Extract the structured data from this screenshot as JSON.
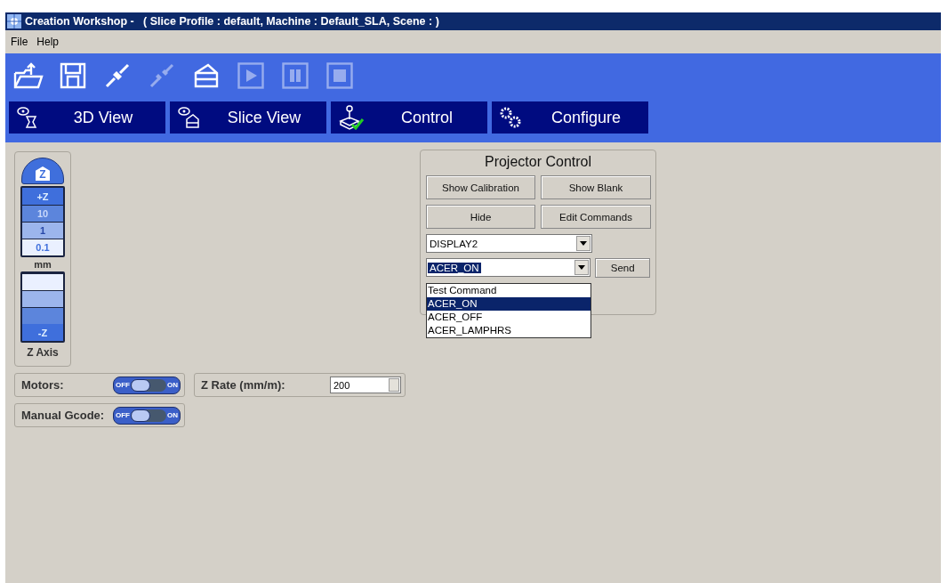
{
  "window": {
    "title": "Creation Workshop -   ( Slice Profile : default, Machine : Default_SLA, Scene : )"
  },
  "menu": [
    "File",
    "Help"
  ],
  "toolbar": [
    {
      "kind": "open",
      "disabled": false
    },
    {
      "kind": "save",
      "disabled": false
    },
    {
      "kind": "connect",
      "disabled": false
    },
    {
      "kind": "disconnect",
      "disabled": true
    },
    {
      "kind": "slice",
      "disabled": false
    },
    {
      "kind": "play",
      "disabled": true
    },
    {
      "kind": "pause",
      "disabled": true
    },
    {
      "kind": "stop",
      "disabled": true
    }
  ],
  "tabs": [
    {
      "kind": "view3d",
      "label": "3D View"
    },
    {
      "kind": "slice",
      "label": "Slice View"
    },
    {
      "kind": "control",
      "label": "Control"
    },
    {
      "kind": "configure",
      "label": "Configure"
    }
  ],
  "z_axis": {
    "home": "Z",
    "up": "+Z",
    "down": "-Z",
    "unit": "mm",
    "label": "Z Axis",
    "steps": [
      {
        "label": "10",
        "selected": false
      },
      {
        "label": "1",
        "selected": false
      },
      {
        "label": "0.1",
        "selected": true
      }
    ]
  },
  "motors": {
    "label": "Motors:",
    "on": false,
    "off_text": "OFF",
    "on_text": "ON"
  },
  "z_rate": {
    "label": "Z Rate (mm/m):",
    "value": "200"
  },
  "manual_gcode": {
    "label": "Manual Gcode:",
    "on": false,
    "off_text": "OFF",
    "on_text": "ON"
  },
  "projector": {
    "title": "Projector Control",
    "buttons": [
      "Show Calibration",
      "Show Blank",
      "Hide",
      "Edit Commands"
    ],
    "display": "DISPLAY2",
    "command": "ACER_ON",
    "send": "Send",
    "options": [
      {
        "label": "Test Command",
        "selected": false
      },
      {
        "label": "ACER_ON",
        "selected": true
      },
      {
        "label": "ACER_OFF",
        "selected": false
      },
      {
        "label": "ACER_LAMPHRS",
        "selected": false
      }
    ]
  }
}
